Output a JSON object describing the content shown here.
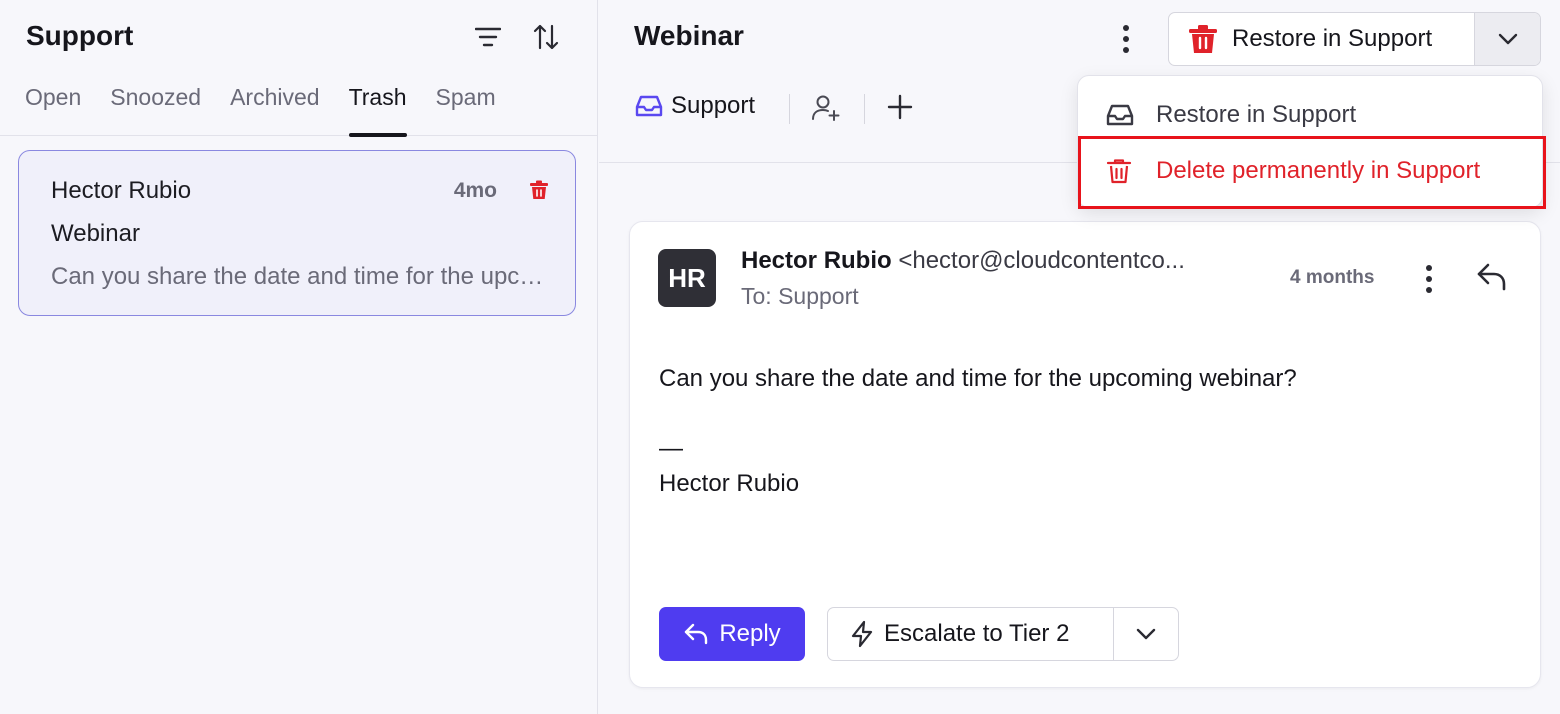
{
  "left": {
    "title": "Support",
    "tabs": [
      {
        "label": "Open"
      },
      {
        "label": "Snoozed"
      },
      {
        "label": "Archived"
      },
      {
        "label": "Trash",
        "active": true
      },
      {
        "label": "Spam"
      }
    ],
    "conversation": {
      "name": "Hector Rubio",
      "time": "4mo",
      "subject": "Webinar",
      "preview": "Can you share the date and time for the upcoming webinar?"
    }
  },
  "header": {
    "title": "Webinar",
    "restore_label": "Restore in Support",
    "inbox_label": "Support"
  },
  "dropdown": {
    "items": [
      {
        "label": "Restore in Support",
        "icon": "inbox-icon"
      },
      {
        "label": "Delete permanently in Support",
        "icon": "trash-icon"
      }
    ]
  },
  "message": {
    "avatar_initials": "HR",
    "from_name": "Hector Rubio",
    "from_email": "<hector@cloudcontentco...",
    "to": "To: Support",
    "time": "4 months",
    "body": "Can you share the date and time for the upcoming webinar?",
    "signature_dash": "—",
    "signature_name": "Hector Rubio"
  },
  "actions": {
    "reply_label": "Reply",
    "escalate_label": "Escalate to Tier 2"
  },
  "colors": {
    "accent": "#4f3cf0",
    "danger": "#e0222a",
    "highlight": "#e8131b"
  }
}
